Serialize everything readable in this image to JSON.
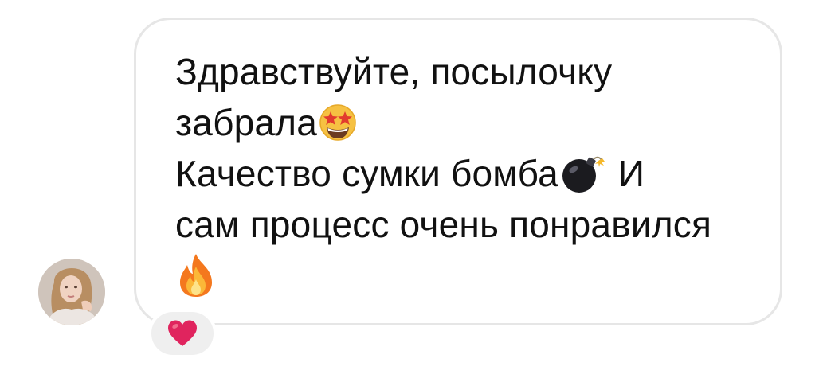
{
  "message": {
    "line1": "Здравствуйте, посылочку",
    "line2": "забрала",
    "line3a": "Качество сумки бомба",
    "line3b": " И",
    "line4": "сам процесс очень понравился",
    "emoji_star_struck": "star-struck-emoji",
    "emoji_bomb": "bomb-emoji",
    "emoji_fire": "fire-emoji"
  },
  "reaction": {
    "emoji": "red-heart-emoji",
    "color": "#e0245e"
  },
  "colors": {
    "bubble_border": "#e6e6e6",
    "reaction_bg": "#efefef",
    "text": "#111111"
  }
}
